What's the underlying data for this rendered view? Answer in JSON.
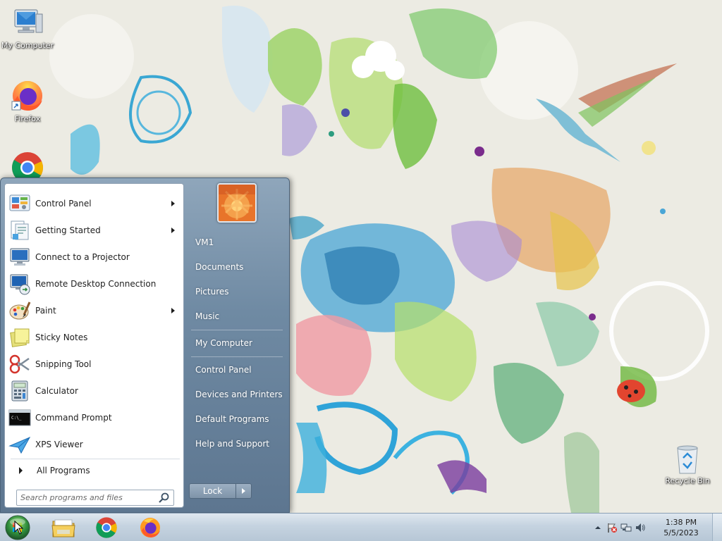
{
  "desktop": {
    "icons": [
      {
        "label": "My Computer",
        "icon": "computer-icon"
      },
      {
        "label": "Firefox",
        "icon": "firefox-icon"
      },
      {
        "label": "",
        "icon": "chrome-icon"
      },
      {
        "label": "Recycle Bin",
        "icon": "recycle-bin-icon"
      }
    ]
  },
  "start_menu": {
    "programs": [
      {
        "label": "Control Panel",
        "icon": "control-panel-icon",
        "submenu": true
      },
      {
        "label": "Getting Started",
        "icon": "getting-started-icon",
        "submenu": true
      },
      {
        "label": "Connect to a Projector",
        "icon": "projector-icon",
        "submenu": false
      },
      {
        "label": "Remote Desktop Connection",
        "icon": "remote-desktop-icon",
        "submenu": false
      },
      {
        "label": "Paint",
        "icon": "paint-icon",
        "submenu": true
      },
      {
        "label": "Sticky Notes",
        "icon": "sticky-notes-icon",
        "submenu": false
      },
      {
        "label": "Snipping Tool",
        "icon": "snipping-tool-icon",
        "submenu": false
      },
      {
        "label": "Calculator",
        "icon": "calculator-icon",
        "submenu": false
      },
      {
        "label": "Command Prompt",
        "icon": "command-prompt-icon",
        "submenu": false
      },
      {
        "label": "XPS Viewer",
        "icon": "xps-viewer-icon",
        "submenu": false
      }
    ],
    "all_programs_label": "All Programs",
    "search_placeholder": "Search programs and files",
    "right_items": {
      "user": "VM1",
      "documents": "Documents",
      "pictures": "Pictures",
      "music": "Music",
      "computer": "My Computer",
      "control_panel": "Control Panel",
      "devices": "Devices and Printers",
      "defaults": "Default Programs",
      "help": "Help and Support"
    },
    "lock_label": "Lock"
  },
  "taskbar": {
    "pinned": [
      {
        "name": "windows-explorer-icon"
      },
      {
        "name": "chrome-icon"
      },
      {
        "name": "firefox-icon"
      }
    ],
    "clock_time": "1:38 PM",
    "clock_date": "5/5/2023"
  }
}
